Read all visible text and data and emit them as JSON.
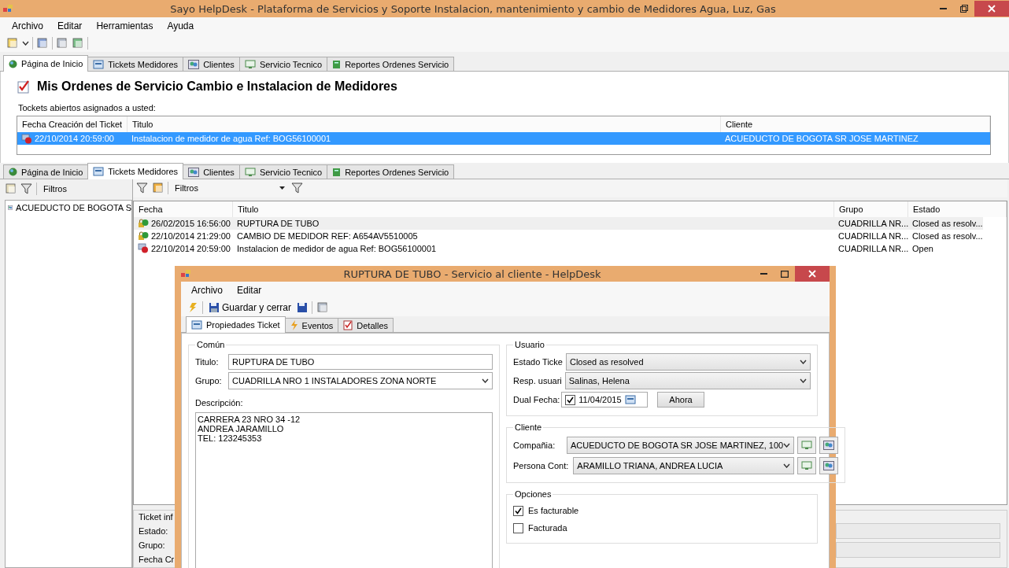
{
  "window": {
    "title": "Sayo HelpDesk - Plataforma de Servicios y Soporte Instalacion, mantenimiento y cambio de Medidores Agua, Luz, Gas"
  },
  "menu": [
    "Archivo",
    "Editar",
    "Herramientas",
    "Ayuda"
  ],
  "top_tabs": [
    {
      "label": "Página de Inicio",
      "selected": true
    },
    {
      "label": "Tickets Medidores",
      "selected": false
    },
    {
      "label": "Clientes",
      "selected": false
    },
    {
      "label": "Servicio Tecnico",
      "selected": false
    },
    {
      "label": "Reportes Ordenes Servicio",
      "selected": false
    }
  ],
  "home": {
    "heading": "Mis Ordenes de Servicio Cambio e Instalacion de Medidores",
    "subtitle": "Tockets abiertos asignados a usted:",
    "columns": [
      "Fecha Creación del Ticket",
      "Titulo",
      "Cliente"
    ],
    "rows": [
      {
        "cells": [
          "22/10/2014 20:59:00",
          "Instalacion de medidor de agua Ref: BOG56100001",
          "ACUEDUCTO DE BOGOTA SR JOSE MARTINEZ"
        ],
        "kind": "open",
        "selected": true
      }
    ]
  },
  "tabs": [
    {
      "label": "Página de Inicio",
      "selected": false
    },
    {
      "label": "Tickets Medidores",
      "selected": true
    },
    {
      "label": "Clientes",
      "selected": false
    },
    {
      "label": "Servicio Tecnico",
      "selected": false
    },
    {
      "label": "Reportes Ordenes Servicio",
      "selected": false
    }
  ],
  "left_pane": {
    "filter_label": "Filtros",
    "items": [
      "ACUEDUCTO DE BOGOTA S"
    ]
  },
  "tickets": {
    "filter_label": "Filtros",
    "columns": [
      "Fecha",
      "Titulo",
      "Grupo",
      "Estado"
    ],
    "rows": [
      {
        "cells": [
          "26/02/2015 16:56:00",
          "RUPTURA DE TUBO",
          "CUADRILLA NR...",
          "Closed as resolv..."
        ],
        "kind": "closed",
        "selected": true
      },
      {
        "cells": [
          "22/10/2014 21:29:00",
          "CAMBIO DE MEDIDOR REF: A654AV5510005",
          "CUADRILLA NR...",
          "Closed as resolv..."
        ],
        "kind": "closed",
        "selected": false
      },
      {
        "cells": [
          "22/10/2014 20:59:00",
          "Instalacion de medidor de agua Ref: BOG56100001",
          "CUADRILLA NR...",
          "Open"
        ],
        "kind": "open",
        "selected": false
      }
    ]
  },
  "ticket_info": {
    "legend": "Ticket inf",
    "labels": [
      "Estado:",
      "Grupo:",
      "Fecha Cr"
    ]
  },
  "dialog": {
    "title": "RUPTURA DE TUBO - Servicio al cliente - HelpDesk",
    "menu": [
      "Archivo",
      "Editar"
    ],
    "save_close": "Guardar y cerrar",
    "tabs": [
      {
        "label": "Propiedades Ticket",
        "selected": true
      },
      {
        "label": "Eventos",
        "selected": false
      },
      {
        "label": "Detalles",
        "selected": false
      }
    ],
    "common": {
      "legend": "Común",
      "title_label": "Titulo:",
      "title_value": "RUPTURA DE TUBO",
      "group_label": "Grupo:",
      "group_value": "CUADRILLA NRO 1 INSTALADORES ZONA NORTE",
      "description_label": "Descripción:",
      "description": "CARRERA 23 NRO 34 -12\nANDREA JARAMILLO\nTEL: 123245353"
    },
    "user": {
      "legend": "Usuario",
      "fields": [
        {
          "label": "Estado Ticke",
          "value": "Closed as resolved"
        },
        {
          "label": "Resp. usuari",
          "value": "Salinas, Helena"
        }
      ],
      "date_label": "Dual Fecha:",
      "date_checked": true,
      "date": "11/04/2015",
      "now_button": "Ahora"
    },
    "client": {
      "legend": "Cliente",
      "fields": [
        {
          "label": "Compañia:",
          "value": "ACUEDUCTO DE BOGOTA SR JOSE MARTINEZ, 100"
        },
        {
          "label": "Persona Cont:",
          "value": "ARAMILLO TRIANA, ANDREA LUCIA"
        }
      ]
    },
    "options": {
      "legend": "Opciones",
      "items": [
        {
          "label": "Es facturable",
          "checked": true
        },
        {
          "label": "Facturada",
          "checked": false
        }
      ]
    }
  }
}
